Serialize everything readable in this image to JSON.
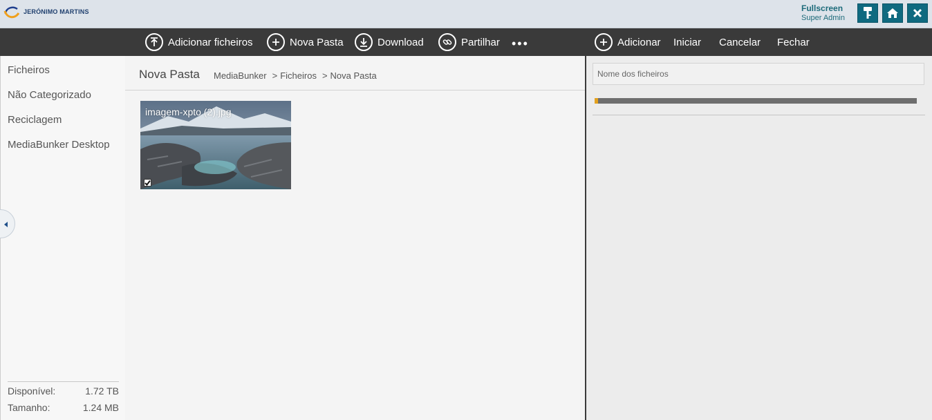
{
  "header": {
    "brand": "JERÓNIMO MARTINS",
    "user_name": "Fullscreen",
    "user_role": "Super Admin",
    "accent_color": "#0f6a80",
    "buttons": [
      {
        "icon": "key-icon"
      },
      {
        "icon": "home-icon"
      },
      {
        "icon": "close-icon"
      }
    ]
  },
  "toolbar": {
    "add_files": "Adicionar ficheiros",
    "new_folder": "Nova Pasta",
    "download": "Download",
    "share": "Partilhar",
    "more": "•••"
  },
  "sidebar": {
    "items": [
      {
        "label": "Ficheiros"
      },
      {
        "label": "Não Categorizado"
      },
      {
        "label": "Reciclagem"
      },
      {
        "label": "MediaBunker Desktop"
      }
    ],
    "storage": {
      "available_label": "Disponível:",
      "available_value": "1.72 TB",
      "size_label": "Tamanho:",
      "size_value": "1.24 MB"
    }
  },
  "main": {
    "title": "Nova Pasta",
    "breadcrumb": [
      "MediaBunker",
      "Ficheiros",
      "Nova Pasta"
    ],
    "breadcrumb_separator": ">",
    "files": [
      {
        "name": "imagem-xpto (2).jpg",
        "checked": true
      }
    ]
  },
  "upload_panel": {
    "add": "Adicionar",
    "start": "Iniciar",
    "cancel": "Cancelar",
    "close": "Fechar",
    "filename_placeholder": "Nome dos ficheiros",
    "progress": 0.01,
    "progress_color": "#e3a11e"
  }
}
